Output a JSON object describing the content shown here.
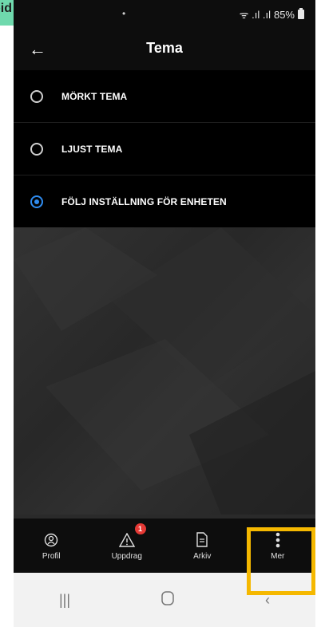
{
  "status_bar": {
    "signal": "ᯤ .ıl .ıl",
    "battery": "85%"
  },
  "header": {
    "title": "Tema",
    "back_icon": "arrow-left-icon"
  },
  "theme_options": [
    {
      "label": "MÖRKT TEMA",
      "selected": false
    },
    {
      "label": "LJUST TEMA",
      "selected": false
    },
    {
      "label": "FÖLJ INSTÄLLNING FÖR ENHETEN",
      "selected": true
    }
  ],
  "bottom_nav": {
    "items": [
      {
        "label": "Profil",
        "icon": "profile-icon"
      },
      {
        "label": "Uppdrag",
        "icon": "warning-icon",
        "badge": "1"
      },
      {
        "label": "Arkiv",
        "icon": "document-icon"
      },
      {
        "label": "Mer",
        "icon": "more-vertical-icon"
      }
    ]
  },
  "overlay_label": "oid",
  "colors": {
    "accent": "#2f8cf0",
    "highlight": "#f5b800",
    "badge": "#e53935"
  }
}
